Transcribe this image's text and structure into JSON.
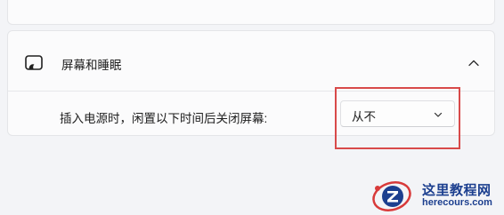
{
  "section": {
    "title": "屏幕和睡眠",
    "icon": "monitor-sleep-icon",
    "expanded": true
  },
  "setting": {
    "label": "插入电源时，闲置以下时间后关闭屏幕:",
    "dropdown_value": "从不"
  },
  "annotation": {
    "color": "#d84a4a"
  },
  "watermark": {
    "title": "这里教程网",
    "url": "herecours.com",
    "color": "#1c3f8f"
  },
  "colors": {
    "background": "#f3f4f7",
    "card": "#fbfbfc"
  }
}
